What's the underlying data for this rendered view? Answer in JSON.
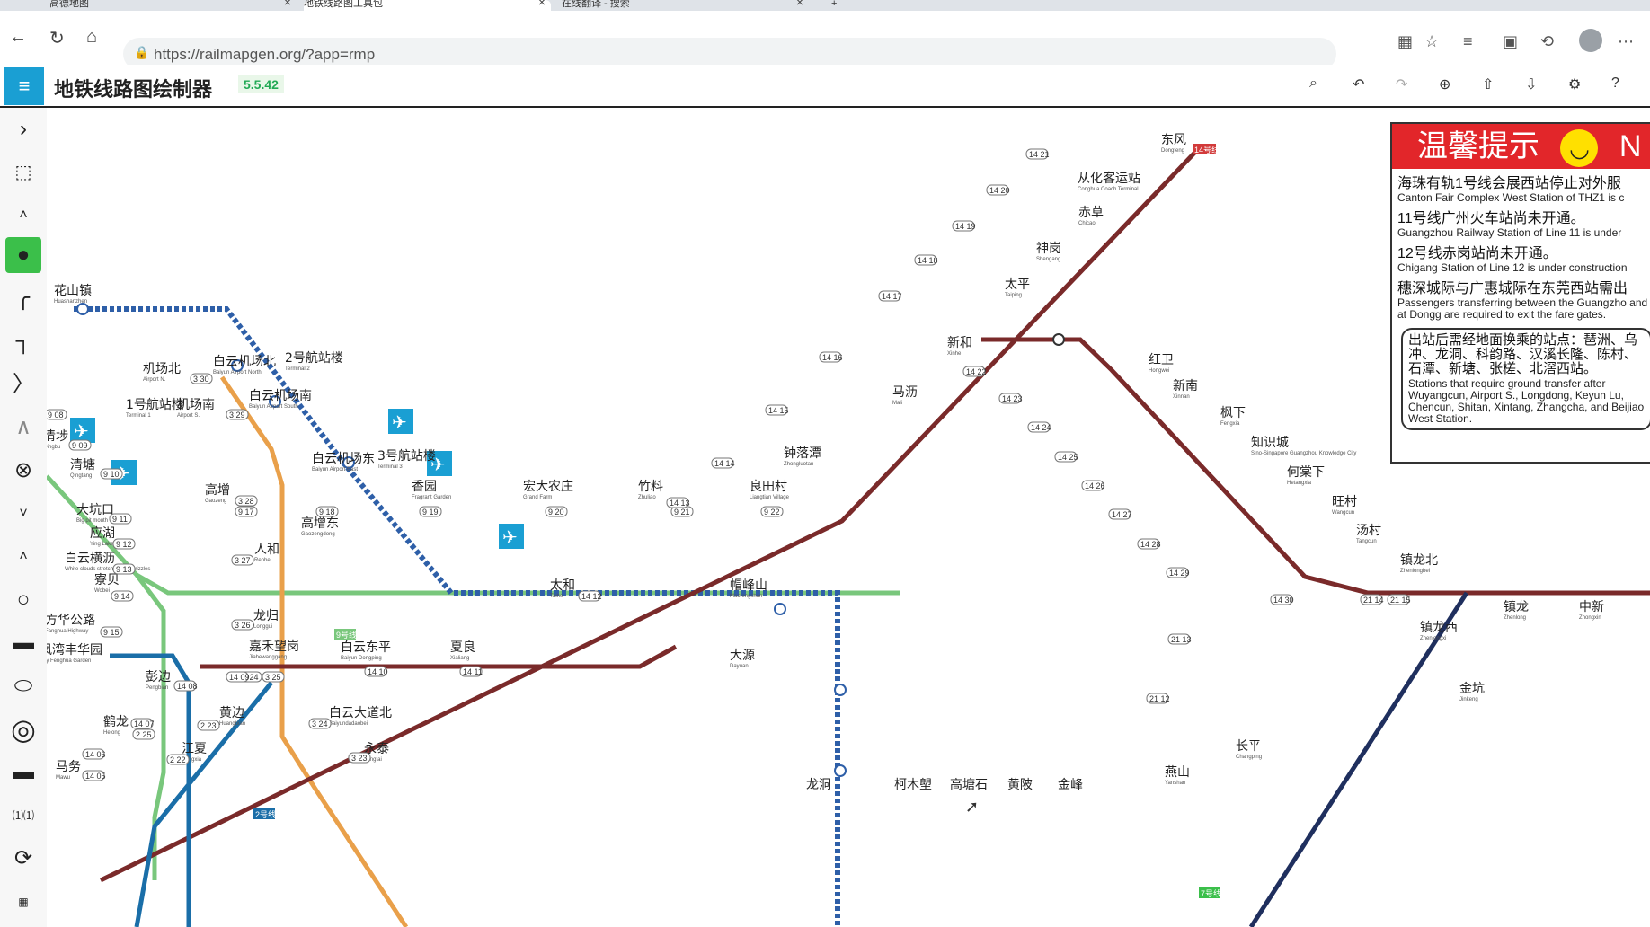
{
  "browser": {
    "tabs": [
      {
        "title": "高德地图",
        "active": false
      },
      {
        "title": "地铁线路图工具包",
        "active": true
      },
      {
        "title": "在线翻译 - 搜索",
        "active": false
      }
    ],
    "url": "https://railmapgen.org/?app=rmp"
  },
  "app": {
    "title": "地铁线路图绘制器",
    "version": "5.5.42"
  },
  "colors": {
    "line3": "#e9a04a",
    "line9": "#79c77c",
    "line14": "#7a2a2a",
    "line21": "#1f2f5e",
    "line2": "#1a6ea8",
    "apm": "#2e5fa8",
    "accent": "#1a9fd3",
    "notice_red": "#e2262a"
  },
  "stations": [
    {
      "zh": "花山镇",
      "en": "Huashanzhen"
    },
    {
      "zh": "白云机场北",
      "en": "Baiyun Airport North"
    },
    {
      "zh": "2号航站楼",
      "en": "Terminal 2"
    },
    {
      "zh": "机场北",
      "en": "Airport N."
    },
    {
      "zh": "白云机场南",
      "en": "Baiyun Airport South"
    },
    {
      "zh": "1号航站楼",
      "en": "Terminal 1"
    },
    {
      "zh": "机场南",
      "en": "Airport S."
    },
    {
      "zh": "白云机场东",
      "en": "Baiyun Airport East"
    },
    {
      "zh": "3号航站楼",
      "en": "Terminal 3"
    },
    {
      "zh": "清塘",
      "en": "Qingtang"
    },
    {
      "zh": "清埗",
      "en": "Qingbu"
    },
    {
      "zh": "高增",
      "en": "Gaozeng"
    },
    {
      "zh": "香园",
      "en": "Fragrant Garden"
    },
    {
      "zh": "宏大农庄",
      "en": "Grand Farm"
    },
    {
      "zh": "竹料",
      "en": "Zhuliao"
    },
    {
      "zh": "良田村",
      "en": "Liangtian Village"
    },
    {
      "zh": "大坑口",
      "en": "Big pit mouth"
    },
    {
      "zh": "应湖",
      "en": "Ying Lake"
    },
    {
      "zh": "白云横沥",
      "en": "White clouds stretch across drizzles"
    },
    {
      "zh": "寮贝",
      "en": "Wobei"
    },
    {
      "zh": "方华公路",
      "en": "Fanghua Highway"
    },
    {
      "zh": "凤湾丰华园",
      "en": "Bay Fenghua Garden"
    },
    {
      "zh": "高增东",
      "en": "Gaozengdong"
    },
    {
      "zh": "人和",
      "en": "Renhe"
    },
    {
      "zh": "龙归",
      "en": "Longgui"
    },
    {
      "zh": "嘉禾望岗",
      "en": "Jiahewanggang"
    },
    {
      "zh": "白云东平",
      "en": "Baiyun Dongping"
    },
    {
      "zh": "夏良",
      "en": "Xialiang"
    },
    {
      "zh": "太和",
      "en": "Taihe"
    },
    {
      "zh": "帽峰山",
      "en": "Maofengshan"
    },
    {
      "zh": "大源",
      "en": "Dayuan"
    },
    {
      "zh": "彭边",
      "en": "Pengbian"
    },
    {
      "zh": "鹤龙",
      "en": "Helong"
    },
    {
      "zh": "黄边",
      "en": "Huangbian"
    },
    {
      "zh": "白云大道北",
      "en": "Baiyundadaobei"
    },
    {
      "zh": "江夏",
      "en": "Jiangxia"
    },
    {
      "zh": "永泰",
      "en": "Yongtai"
    },
    {
      "zh": "马务",
      "en": "Mawu"
    },
    {
      "zh": "东风",
      "en": "Dongfeng"
    },
    {
      "zh": "从化客运站",
      "en": "Conghua Coach Terminal"
    },
    {
      "zh": "赤草",
      "en": "Chicao"
    },
    {
      "zh": "神岗",
      "en": "Shengang"
    },
    {
      "zh": "太平",
      "en": "Taiping"
    },
    {
      "zh": "新和",
      "en": "Xinhe"
    },
    {
      "zh": "马沥",
      "en": "Mali"
    },
    {
      "zh": "钟落潭",
      "en": "Zhongluotan"
    },
    {
      "zh": "红卫",
      "en": "Hongwei"
    },
    {
      "zh": "新南",
      "en": "Xinnan"
    },
    {
      "zh": "枫下",
      "en": "Fengxia"
    },
    {
      "zh": "知识城",
      "en": "Sino-Singapore Guangzhou Knowledge City"
    },
    {
      "zh": "何棠下",
      "en": "Hetangxia"
    },
    {
      "zh": "旺村",
      "en": "Wangcun"
    },
    {
      "zh": "汤村",
      "en": "Tangcun"
    },
    {
      "zh": "镇龙北",
      "en": "Zhenlongbei"
    },
    {
      "zh": "镇龙",
      "en": "Zhenlong"
    },
    {
      "zh": "中新",
      "en": "Zhongxin"
    },
    {
      "zh": "镇龙西",
      "en": "Zhenlongxi"
    },
    {
      "zh": "金坑",
      "en": "Jinkeng"
    },
    {
      "zh": "长平",
      "en": "Changping"
    },
    {
      "zh": "燕山",
      "en": "Yanshan"
    },
    {
      "zh": "龙洞",
      "en": ""
    },
    {
      "zh": "柯木塱",
      "en": ""
    },
    {
      "zh": "高塘石",
      "en": ""
    },
    {
      "zh": "黄陂",
      "en": ""
    },
    {
      "zh": "金峰",
      "en": ""
    }
  ],
  "badges": [
    "3|30",
    "3|29",
    "3|28",
    "9|17",
    "9|18",
    "9|19",
    "9|20",
    "9|21",
    "9|22",
    "14|13",
    "14|14",
    "14|15",
    "14|16",
    "14|17",
    "14|18",
    "14|19",
    "14|20",
    "14|21",
    "14|22",
    "14|23",
    "14|24",
    "14|25",
    "14|26",
    "14|27",
    "14|28",
    "14|29",
    "14|30",
    "21|14",
    "21|15",
    "21|13",
    "21|12",
    "9|08",
    "9|09",
    "9|10",
    "9|11",
    "9|12",
    "9|13",
    "9|14",
    "9|15",
    "3|27",
    "3|26",
    "14|08",
    "14|07",
    "2|25",
    "2|24",
    "3|25",
    "3|24",
    "2|23",
    "2|22",
    "14|06",
    "14|05",
    "3|23",
    "14|09",
    "14|10",
    "14|11",
    "14|12"
  ],
  "line_labels": [
    "14号线",
    "9号线",
    "2号线",
    "7号线"
  ],
  "notice": {
    "title": "温馨提示",
    "title_tail": "N",
    "items": [
      {
        "zh": "海珠有轨1号线会展西站停止对外服",
        "en": "Canton Fair Complex West Station of THZ1 is c"
      },
      {
        "zh": "11号线广州火车站尚未开通。",
        "en": "Guangzhou Railway Station of Line 11 is under"
      },
      {
        "zh": "12号线赤岗站尚未开通。",
        "en": "Chigang Station of Line 12 is under construction"
      },
      {
        "zh": "穗深城际与广惠城际在东莞西站需出",
        "en": "Passengers transferring between the Guangzho and the Guangzhou-Huizhou Intercity at Dongg are required to exit the fare gates."
      }
    ],
    "transfer_zh": "出站后需经地面换乘的站点：琶洲、乌冲、龙洞、科韵路、汉溪长隆、陈村、石潭、新塘、张槎、北滘西站。",
    "transfer_en": "Stations that require ground transfer after Wuyangcun, Airport S., Longdong, Keyun Lu, Chencun, Shitan, Xintang, Zhangcha, and Beijiao West Station."
  }
}
